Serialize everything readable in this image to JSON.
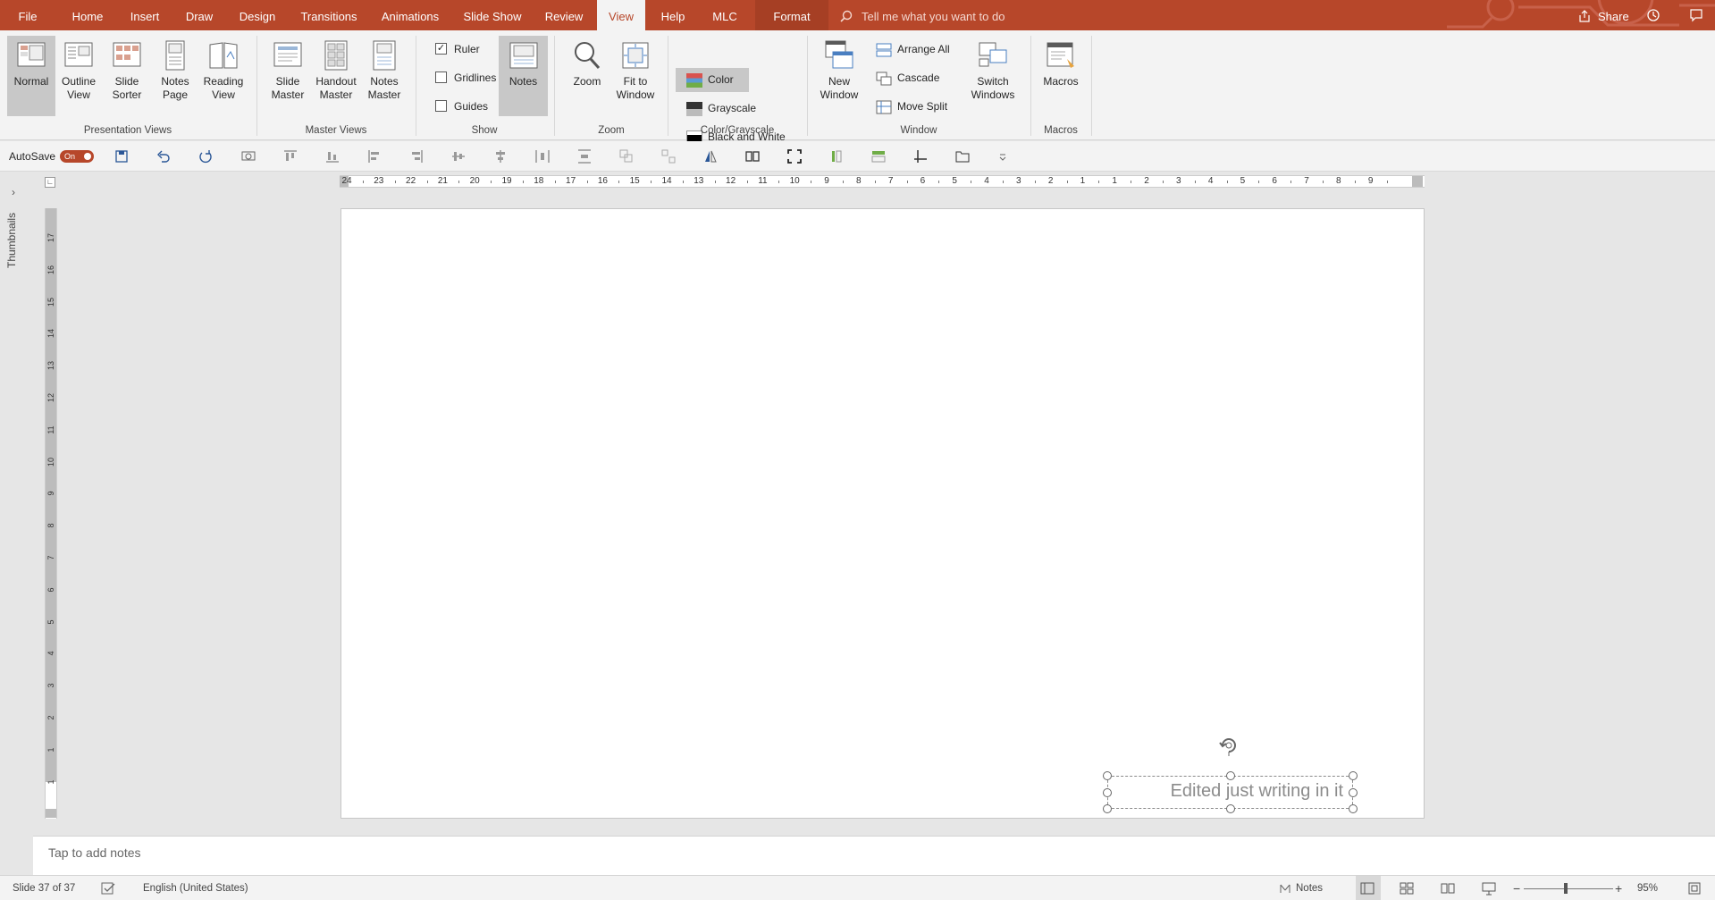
{
  "tabs": {
    "file": "File",
    "home": "Home",
    "insert": "Insert",
    "draw": "Draw",
    "design": "Design",
    "transitions": "Transitions",
    "animations": "Animations",
    "slideshow": "Slide Show",
    "review": "Review",
    "view": "View",
    "help": "Help",
    "mlc": "MLC",
    "format": "Format"
  },
  "search": {
    "placeholder": "Tell me what you want to do"
  },
  "share": {
    "label": "Share"
  },
  "ribbon": {
    "presentation_views": {
      "label": "Presentation Views",
      "normal": "Normal",
      "outline": "Outline\nView",
      "sorter": "Slide\nSorter",
      "notes_page": "Notes\nPage",
      "reading": "Reading\nView"
    },
    "master_views": {
      "label": "Master Views",
      "slide_master": "Slide\nMaster",
      "handout_master": "Handout\nMaster",
      "notes_master": "Notes\nMaster"
    },
    "show": {
      "label": "Show",
      "ruler": "Ruler",
      "gridlines": "Gridlines",
      "guides": "Guides",
      "notes": "Notes"
    },
    "zoom": {
      "label": "Zoom",
      "zoom": "Zoom",
      "fit": "Fit to\nWindow"
    },
    "color": {
      "label": "Color/Grayscale",
      "color": "Color",
      "grayscale": "Grayscale",
      "bw": "Black and White"
    },
    "window": {
      "label": "Window",
      "new_window": "New\nWindow",
      "arrange": "Arrange All",
      "cascade": "Cascade",
      "move_split": "Move Split",
      "switch": "Switch\nWindows"
    },
    "macros": {
      "label": "Macros",
      "macros": "Macros"
    }
  },
  "qat": {
    "autosave": "AutoSave",
    "toggle": "On"
  },
  "thumbnails": {
    "label": "Thumbnails"
  },
  "hruler_labels": [
    "24",
    "23",
    "22",
    "21",
    "20",
    "19",
    "18",
    "17",
    "16",
    "15",
    "14",
    "13",
    "12",
    "11",
    "10",
    "9",
    "8",
    "7",
    "6",
    "5",
    "4",
    "3",
    "2",
    "1",
    "1",
    "2",
    "3",
    "4",
    "5",
    "6",
    "7",
    "8",
    "9"
  ],
  "vruler_labels": [
    "17",
    "16",
    "15",
    "14",
    "13",
    "12",
    "11",
    "10",
    "9",
    "8",
    "7",
    "6",
    "5",
    "4",
    "3",
    "2",
    "1",
    "1"
  ],
  "slide": {
    "textbox_text": "Edited just writing in it"
  },
  "notes": {
    "placeholder": "Tap to add notes"
  },
  "status": {
    "slide_info": "Slide 37 of 37",
    "language": "English (United States)",
    "notes": "Notes",
    "zoom_minus": "−",
    "zoom_plus": "+",
    "zoom_level": "95%"
  },
  "colors": {
    "accent": "#b7472a",
    "ribbon_bg": "#f3f3f3",
    "workspace": "#e6e6e6"
  }
}
